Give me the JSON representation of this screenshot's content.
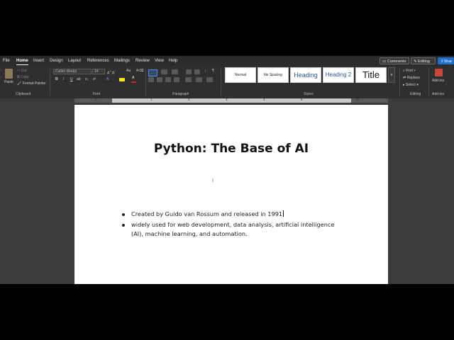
{
  "tabs": [
    "File",
    "Home",
    "Insert",
    "Design",
    "Layout",
    "References",
    "Mailings",
    "Review",
    "View",
    "Help"
  ],
  "active_tab": "Home",
  "top_right": {
    "comments": "Comments",
    "editing": "Editing",
    "share": "Shar"
  },
  "clipboard": {
    "paste": "Paste",
    "cut": "Cut",
    "copy": "Copy",
    "format_painter": "Format Painter",
    "label": "Clipboard"
  },
  "font": {
    "name": "Calibri (Body)",
    "size": "14",
    "label": "Font"
  },
  "paragraph": {
    "label": "Paragraph"
  },
  "styles": {
    "label": "Styles",
    "items": [
      "Normal",
      "No Spacing",
      "Heading",
      "Heading 2",
      "Title"
    ]
  },
  "editing": {
    "find": "Find",
    "replace": "Replace",
    "select": "Select",
    "label": "Editing"
  },
  "addins": {
    "label": "Add-ins",
    "group": "Add-ins"
  },
  "ruler_numbers": [
    "1",
    "1",
    "2",
    "3",
    "4",
    "5",
    "6"
  ],
  "document": {
    "title": "Python: The Base of AI",
    "bullets": [
      {
        "text": "Created by Guido van Rossum and released in 1991"
      },
      {
        "line1": "widely used for web development, data analysis, artificial intelligence",
        "line2": "(AI), machine learning, and automation."
      }
    ]
  }
}
